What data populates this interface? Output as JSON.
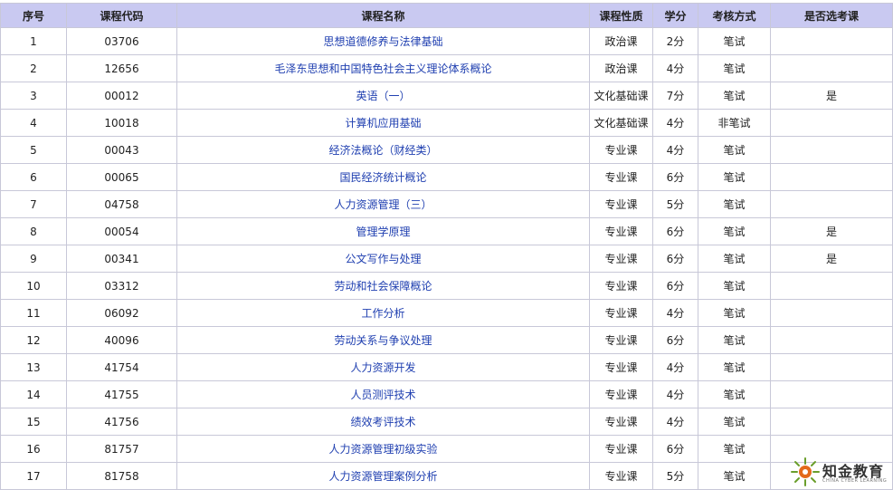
{
  "headers": [
    "序号",
    "课程代码",
    "课程名称",
    "课程性质",
    "学分",
    "考核方式",
    "是否选考课"
  ],
  "rows": [
    {
      "no": "1",
      "code": "03706",
      "name": "思想道德修养与法律基础",
      "type": "政治课",
      "credit": "2分",
      "exam": "笔试",
      "elective": ""
    },
    {
      "no": "2",
      "code": "12656",
      "name": "毛泽东思想和中国特色社会主义理论体系概论",
      "type": "政治课",
      "credit": "4分",
      "exam": "笔试",
      "elective": ""
    },
    {
      "no": "3",
      "code": "00012",
      "name": "英语（一）",
      "type": "文化基础课",
      "credit": "7分",
      "exam": "笔试",
      "elective": "是"
    },
    {
      "no": "4",
      "code": "10018",
      "name": "计算机应用基础",
      "type": "文化基础课",
      "credit": "4分",
      "exam": "非笔试",
      "elective": ""
    },
    {
      "no": "5",
      "code": "00043",
      "name": "经济法概论（财经类）",
      "type": "专业课",
      "credit": "4分",
      "exam": "笔试",
      "elective": ""
    },
    {
      "no": "6",
      "code": "00065",
      "name": "国民经济统计概论",
      "type": "专业课",
      "credit": "6分",
      "exam": "笔试",
      "elective": ""
    },
    {
      "no": "7",
      "code": "04758",
      "name": "人力资源管理（三）",
      "type": "专业课",
      "credit": "5分",
      "exam": "笔试",
      "elective": ""
    },
    {
      "no": "8",
      "code": "00054",
      "name": "管理学原理",
      "type": "专业课",
      "credit": "6分",
      "exam": "笔试",
      "elective": "是"
    },
    {
      "no": "9",
      "code": "00341",
      "name": "公文写作与处理",
      "type": "专业课",
      "credit": "6分",
      "exam": "笔试",
      "elective": "是"
    },
    {
      "no": "10",
      "code": "03312",
      "name": "劳动和社会保障概论",
      "type": "专业课",
      "credit": "6分",
      "exam": "笔试",
      "elective": ""
    },
    {
      "no": "11",
      "code": "06092",
      "name": "工作分析",
      "type": "专业课",
      "credit": "4分",
      "exam": "笔试",
      "elective": ""
    },
    {
      "no": "12",
      "code": "40096",
      "name": "劳动关系与争议处理",
      "type": "专业课",
      "credit": "6分",
      "exam": "笔试",
      "elective": ""
    },
    {
      "no": "13",
      "code": "41754",
      "name": "人力资源开发",
      "type": "专业课",
      "credit": "4分",
      "exam": "笔试",
      "elective": ""
    },
    {
      "no": "14",
      "code": "41755",
      "name": "人员测评技术",
      "type": "专业课",
      "credit": "4分",
      "exam": "笔试",
      "elective": ""
    },
    {
      "no": "15",
      "code": "41756",
      "name": "绩效考评技术",
      "type": "专业课",
      "credit": "4分",
      "exam": "笔试",
      "elective": ""
    },
    {
      "no": "16",
      "code": "81757",
      "name": "人力资源管理初级实验",
      "type": "专业课",
      "credit": "6分",
      "exam": "笔试",
      "elective": ""
    },
    {
      "no": "17",
      "code": "81758",
      "name": "人力资源管理案例分析",
      "type": "专业课",
      "credit": "5分",
      "exam": "笔试",
      "elective": ""
    }
  ],
  "watermark": {
    "brand": "知金教育",
    "sub": "CHINA CYBER LEARNING"
  },
  "colors": {
    "header_bg": "#c9c9f1",
    "link": "#1f3fb0",
    "border": "#c8c8d8"
  }
}
